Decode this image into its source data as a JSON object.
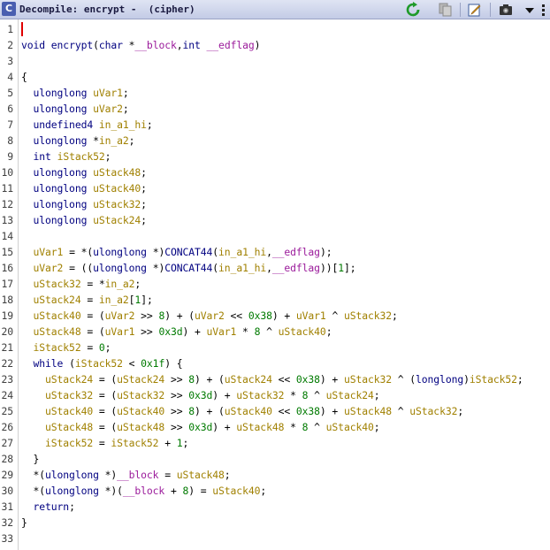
{
  "window": {
    "title": "Decompile: encrypt -  (cipher)",
    "icon_label": "C",
    "toolbar": [
      {
        "name": "refresh-icon"
      },
      {
        "name": "copy-icon"
      },
      {
        "name": "edit-icon"
      },
      {
        "name": "snapshot-icon"
      },
      {
        "name": "menu-arrow-icon"
      }
    ]
  },
  "colors": {
    "keyword": "#000080",
    "variable": "#a08000",
    "parameter": "#9b1b9b",
    "global": "#c07000",
    "number": "#007a00",
    "cursor": "#e00000"
  },
  "code_lines": [
    {
      "n": "1",
      "t": []
    },
    {
      "n": "2",
      "t": [
        [
          "ty",
          "void"
        ],
        [
          "op",
          " "
        ],
        [
          "fn",
          "encrypt"
        ],
        [
          "op",
          "("
        ],
        [
          "ty",
          "char"
        ],
        [
          "op",
          " *"
        ],
        [
          "par",
          "__block"
        ],
        [
          "op",
          ","
        ],
        [
          "ty",
          "int"
        ],
        [
          "op",
          " "
        ],
        [
          "par",
          "__edflag"
        ],
        [
          "op",
          ")"
        ]
      ]
    },
    {
      "n": "3",
      "t": []
    },
    {
      "n": "4",
      "t": [
        [
          "op",
          "{"
        ]
      ]
    },
    {
      "n": "5",
      "t": [
        [
          "op",
          "  "
        ],
        [
          "ty",
          "ulonglong"
        ],
        [
          "op",
          " "
        ],
        [
          "var",
          "uVar1"
        ],
        [
          "op",
          ";"
        ]
      ]
    },
    {
      "n": "6",
      "t": [
        [
          "op",
          "  "
        ],
        [
          "ty",
          "ulonglong"
        ],
        [
          "op",
          " "
        ],
        [
          "var",
          "uVar2"
        ],
        [
          "op",
          ";"
        ]
      ]
    },
    {
      "n": "7",
      "t": [
        [
          "op",
          "  "
        ],
        [
          "ty",
          "undefined4"
        ],
        [
          "op",
          " "
        ],
        [
          "var",
          "in_a1_hi"
        ],
        [
          "op",
          ";"
        ]
      ]
    },
    {
      "n": "8",
      "t": [
        [
          "op",
          "  "
        ],
        [
          "ty",
          "ulonglong"
        ],
        [
          "op",
          " *"
        ],
        [
          "var",
          "in_a2"
        ],
        [
          "op",
          ";"
        ]
      ]
    },
    {
      "n": "9",
      "t": [
        [
          "op",
          "  "
        ],
        [
          "ty",
          "int"
        ],
        [
          "op",
          " "
        ],
        [
          "var",
          "iStack52"
        ],
        [
          "op",
          ";"
        ]
      ]
    },
    {
      "n": "10",
      "t": [
        [
          "op",
          "  "
        ],
        [
          "ty",
          "ulonglong"
        ],
        [
          "op",
          " "
        ],
        [
          "var",
          "uStack48"
        ],
        [
          "op",
          ";"
        ]
      ]
    },
    {
      "n": "11",
      "t": [
        [
          "op",
          "  "
        ],
        [
          "ty",
          "ulonglong"
        ],
        [
          "op",
          " "
        ],
        [
          "var",
          "uStack40"
        ],
        [
          "op",
          ";"
        ]
      ]
    },
    {
      "n": "12",
      "t": [
        [
          "op",
          "  "
        ],
        [
          "ty",
          "ulonglong"
        ],
        [
          "op",
          " "
        ],
        [
          "var",
          "uStack32"
        ],
        [
          "op",
          ";"
        ]
      ]
    },
    {
      "n": "13",
      "t": [
        [
          "op",
          "  "
        ],
        [
          "ty",
          "ulonglong"
        ],
        [
          "op",
          " "
        ],
        [
          "var",
          "uStack24"
        ],
        [
          "op",
          ";"
        ]
      ]
    },
    {
      "n": "14",
      "t": []
    },
    {
      "n": "15",
      "t": [
        [
          "op",
          "  "
        ],
        [
          "var",
          "uVar1"
        ],
        [
          "op",
          " = *("
        ],
        [
          "ty",
          "ulonglong"
        ],
        [
          "op",
          " *)"
        ],
        [
          "fn",
          "CONCAT44"
        ],
        [
          "op",
          "("
        ],
        [
          "var",
          "in_a1_hi"
        ],
        [
          "op",
          ","
        ],
        [
          "par",
          "__edflag"
        ],
        [
          "op",
          ");"
        ]
      ]
    },
    {
      "n": "16",
      "t": [
        [
          "op",
          "  "
        ],
        [
          "var",
          "uVar2"
        ],
        [
          "op",
          " = (("
        ],
        [
          "ty",
          "ulonglong"
        ],
        [
          "op",
          " *)"
        ],
        [
          "fn",
          "CONCAT44"
        ],
        [
          "op",
          "("
        ],
        [
          "var",
          "in_a1_hi"
        ],
        [
          "op",
          ","
        ],
        [
          "par",
          "__edflag"
        ],
        [
          "op",
          "))["
        ],
        [
          "num",
          "1"
        ],
        [
          "op",
          "];"
        ]
      ]
    },
    {
      "n": "17",
      "t": [
        [
          "op",
          "  "
        ],
        [
          "var",
          "uStack32"
        ],
        [
          "op",
          " = *"
        ],
        [
          "var",
          "in_a2"
        ],
        [
          "op",
          ";"
        ]
      ]
    },
    {
      "n": "18",
      "t": [
        [
          "op",
          "  "
        ],
        [
          "var",
          "uStack24"
        ],
        [
          "op",
          " = "
        ],
        [
          "var",
          "in_a2"
        ],
        [
          "op",
          "["
        ],
        [
          "num",
          "1"
        ],
        [
          "op",
          "];"
        ]
      ]
    },
    {
      "n": "19",
      "t": [
        [
          "op",
          "  "
        ],
        [
          "var",
          "uStack40"
        ],
        [
          "op",
          " = ("
        ],
        [
          "var",
          "uVar2"
        ],
        [
          "op",
          " >> "
        ],
        [
          "num",
          "8"
        ],
        [
          "op",
          ") + ("
        ],
        [
          "var",
          "uVar2"
        ],
        [
          "op",
          " << "
        ],
        [
          "num",
          "0x38"
        ],
        [
          "op",
          ") + "
        ],
        [
          "var",
          "uVar1"
        ],
        [
          "op",
          " ^ "
        ],
        [
          "var",
          "uStack32"
        ],
        [
          "op",
          ";"
        ]
      ]
    },
    {
      "n": "20",
      "t": [
        [
          "op",
          "  "
        ],
        [
          "var",
          "uStack48"
        ],
        [
          "op",
          " = ("
        ],
        [
          "var",
          "uVar1"
        ],
        [
          "op",
          " >> "
        ],
        [
          "num",
          "0x3d"
        ],
        [
          "op",
          ") + "
        ],
        [
          "var",
          "uVar1"
        ],
        [
          "op",
          " * "
        ],
        [
          "num",
          "8"
        ],
        [
          "op",
          " ^ "
        ],
        [
          "var",
          "uStack40"
        ],
        [
          "op",
          ";"
        ]
      ]
    },
    {
      "n": "21",
      "t": [
        [
          "op",
          "  "
        ],
        [
          "var",
          "iStack52"
        ],
        [
          "op",
          " = "
        ],
        [
          "num",
          "0"
        ],
        [
          "op",
          ";"
        ]
      ]
    },
    {
      "n": "22",
      "t": [
        [
          "op",
          "  "
        ],
        [
          "kw",
          "while"
        ],
        [
          "op",
          " ("
        ],
        [
          "var",
          "iStack52"
        ],
        [
          "op",
          " < "
        ],
        [
          "num",
          "0x1f"
        ],
        [
          "op",
          ") {"
        ]
      ]
    },
    {
      "n": "23",
      "t": [
        [
          "op",
          "    "
        ],
        [
          "var",
          "uStack24"
        ],
        [
          "op",
          " = ("
        ],
        [
          "var",
          "uStack24"
        ],
        [
          "op",
          " >> "
        ],
        [
          "num",
          "8"
        ],
        [
          "op",
          ") + ("
        ],
        [
          "var",
          "uStack24"
        ],
        [
          "op",
          " << "
        ],
        [
          "num",
          "0x38"
        ],
        [
          "op",
          ") + "
        ],
        [
          "var",
          "uStack32"
        ],
        [
          "op",
          " ^ ("
        ],
        [
          "ty",
          "longlong"
        ],
        [
          "op",
          ")"
        ],
        [
          "var",
          "iStack52"
        ],
        [
          "op",
          ";"
        ]
      ]
    },
    {
      "n": "24",
      "t": [
        [
          "op",
          "    "
        ],
        [
          "var",
          "uStack32"
        ],
        [
          "op",
          " = ("
        ],
        [
          "var",
          "uStack32"
        ],
        [
          "op",
          " >> "
        ],
        [
          "num",
          "0x3d"
        ],
        [
          "op",
          ") + "
        ],
        [
          "var",
          "uStack32"
        ],
        [
          "op",
          " * "
        ],
        [
          "num",
          "8"
        ],
        [
          "op",
          " ^ "
        ],
        [
          "var",
          "uStack24"
        ],
        [
          "op",
          ";"
        ]
      ]
    },
    {
      "n": "25",
      "t": [
        [
          "op",
          "    "
        ],
        [
          "var",
          "uStack40"
        ],
        [
          "op",
          " = ("
        ],
        [
          "var",
          "uStack40"
        ],
        [
          "op",
          " >> "
        ],
        [
          "num",
          "8"
        ],
        [
          "op",
          ") + ("
        ],
        [
          "var",
          "uStack40"
        ],
        [
          "op",
          " << "
        ],
        [
          "num",
          "0x38"
        ],
        [
          "op",
          ") + "
        ],
        [
          "var",
          "uStack48"
        ],
        [
          "op",
          " ^ "
        ],
        [
          "var",
          "uStack32"
        ],
        [
          "op",
          ";"
        ]
      ]
    },
    {
      "n": "26",
      "t": [
        [
          "op",
          "    "
        ],
        [
          "var",
          "uStack48"
        ],
        [
          "op",
          " = ("
        ],
        [
          "var",
          "uStack48"
        ],
        [
          "op",
          " >> "
        ],
        [
          "num",
          "0x3d"
        ],
        [
          "op",
          ") + "
        ],
        [
          "var",
          "uStack48"
        ],
        [
          "op",
          " * "
        ],
        [
          "num",
          "8"
        ],
        [
          "op",
          " ^ "
        ],
        [
          "var",
          "uStack40"
        ],
        [
          "op",
          ";"
        ]
      ]
    },
    {
      "n": "27",
      "t": [
        [
          "op",
          "    "
        ],
        [
          "var",
          "iStack52"
        ],
        [
          "op",
          " = "
        ],
        [
          "var",
          "iStack52"
        ],
        [
          "op",
          " + "
        ],
        [
          "num",
          "1"
        ],
        [
          "op",
          ";"
        ]
      ]
    },
    {
      "n": "28",
      "t": [
        [
          "op",
          "  }"
        ]
      ]
    },
    {
      "n": "29",
      "t": [
        [
          "op",
          "  *("
        ],
        [
          "ty",
          "ulonglong"
        ],
        [
          "op",
          " *)"
        ],
        [
          "par",
          "__block"
        ],
        [
          "op",
          " = "
        ],
        [
          "var",
          "uStack48"
        ],
        [
          "op",
          ";"
        ]
      ]
    },
    {
      "n": "30",
      "t": [
        [
          "op",
          "  *("
        ],
        [
          "ty",
          "ulonglong"
        ],
        [
          "op",
          " *)("
        ],
        [
          "par",
          "__block"
        ],
        [
          "op",
          " + "
        ],
        [
          "num",
          "8"
        ],
        [
          "op",
          ") = "
        ],
        [
          "var",
          "uStack40"
        ],
        [
          "op",
          ";"
        ]
      ]
    },
    {
      "n": "31",
      "t": [
        [
          "op",
          "  "
        ],
        [
          "kw",
          "return"
        ],
        [
          "op",
          ";"
        ]
      ]
    },
    {
      "n": "32",
      "t": [
        [
          "op",
          "}"
        ]
      ]
    },
    {
      "n": "33",
      "t": []
    }
  ]
}
